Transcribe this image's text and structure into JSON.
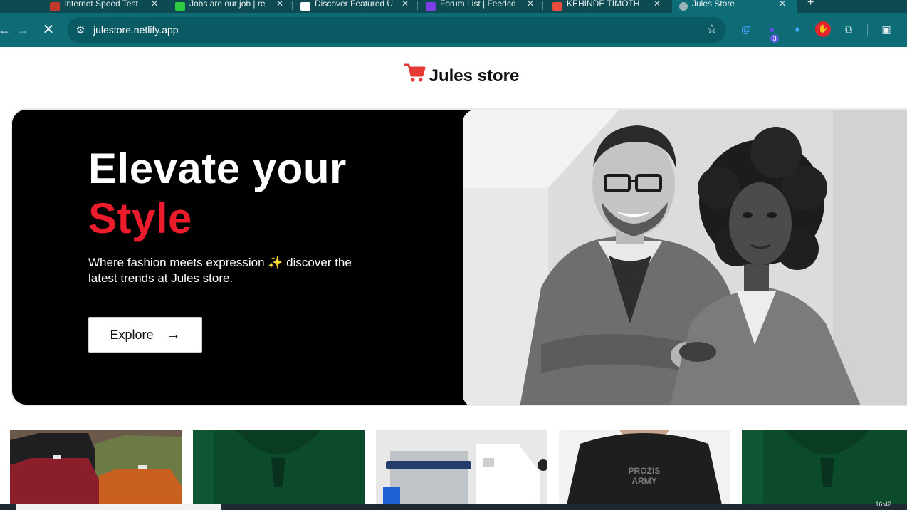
{
  "browser": {
    "tabs": [
      {
        "label": "Internet Speed Test",
        "favicon_color": "#c0392b"
      },
      {
        "label": "Jobs are our job | re",
        "favicon_color": "#2ecc40"
      },
      {
        "label": "Discover Featured U",
        "favicon_color": "#ffffff"
      },
      {
        "label": "Forum List | Feedco",
        "favicon_color": "#7b3fe4"
      },
      {
        "label": "KEHINDE TIMOTH",
        "favicon_color": "#e74c3c"
      },
      {
        "label": "Jules Store",
        "favicon_color": "#9bb3b7",
        "active": true
      }
    ],
    "url": "julestore.netlify.app"
  },
  "page": {
    "brand": "Jules store",
    "hero": {
      "headline_line1": "Elevate your",
      "headline_line2": "Style",
      "subtext": "Where fashion meets expression ✨ discover the latest trends at Jules store.",
      "cta_label": "Explore"
    }
  },
  "taskbar": {
    "clock": "16:42"
  },
  "colors": {
    "accent_red": "#ec1c2c",
    "browser_teal": "#0e6c77"
  }
}
